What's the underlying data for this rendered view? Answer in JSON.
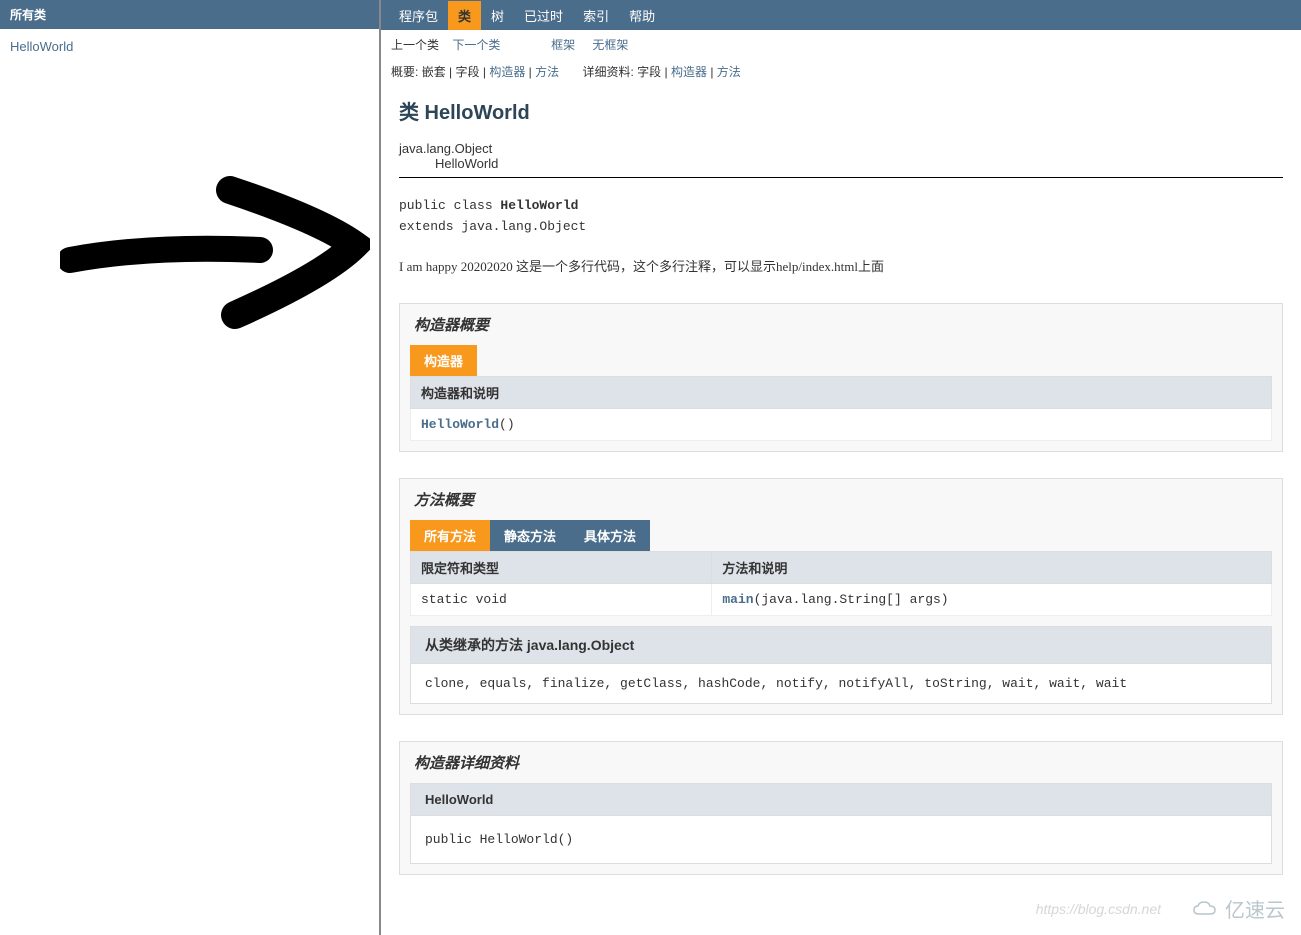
{
  "left": {
    "header": "所有类",
    "items": [
      "HelloWorld"
    ]
  },
  "nav": {
    "items": [
      {
        "label": "程序包",
        "active": false
      },
      {
        "label": "类",
        "active": true
      },
      {
        "label": "树",
        "active": false
      },
      {
        "label": "已过时",
        "active": false
      },
      {
        "label": "索引",
        "active": false
      },
      {
        "label": "帮助",
        "active": false
      }
    ],
    "sub": {
      "prev": "上一个类",
      "next": "下一个类",
      "frames": "框架",
      "noframes": "无框架"
    },
    "summary_label": "概要:",
    "summary": {
      "nested": "嵌套",
      "field": "字段",
      "constr": "构造器",
      "method": "方法"
    },
    "detail_label": "详细资料:",
    "detail": {
      "field": "字段",
      "constr": "构造器",
      "method": "方法"
    }
  },
  "page": {
    "title": "类 HelloWorld",
    "inh1": "java.lang.Object",
    "inh2": "HelloWorld",
    "decl_pre": "public class ",
    "decl_name": "HelloWorld",
    "decl_ext": "extends java.lang.Object",
    "description": "I am happy 20202020 这是一个多行代码，这个多行注释，可以显示help/index.html上面"
  },
  "constr_summary": {
    "title": "构造器概要",
    "tab": "构造器",
    "th": "构造器和说明",
    "row_name": "HelloWorld",
    "row_sig": "()"
  },
  "method_summary": {
    "title": "方法概要",
    "tabs": [
      "所有方法",
      "静态方法",
      "具体方法"
    ],
    "th1": "限定符和类型",
    "th2": "方法和说明",
    "row_mod": "static void",
    "row_name": "main",
    "row_sig": "(java.lang.String[]  args)",
    "inherit_title": "从类继承的方法 java.lang.Object",
    "inherit_list": "clone, equals, finalize, getClass, hashCode, notify, notifyAll, toString, wait, wait, wait"
  },
  "constr_detail": {
    "title": "构造器详细资料",
    "name": "HelloWorld",
    "sig": "public  HelloWorld()"
  },
  "watermark": {
    "url": "https://blog.csdn.net",
    "brand": "亿速云"
  }
}
